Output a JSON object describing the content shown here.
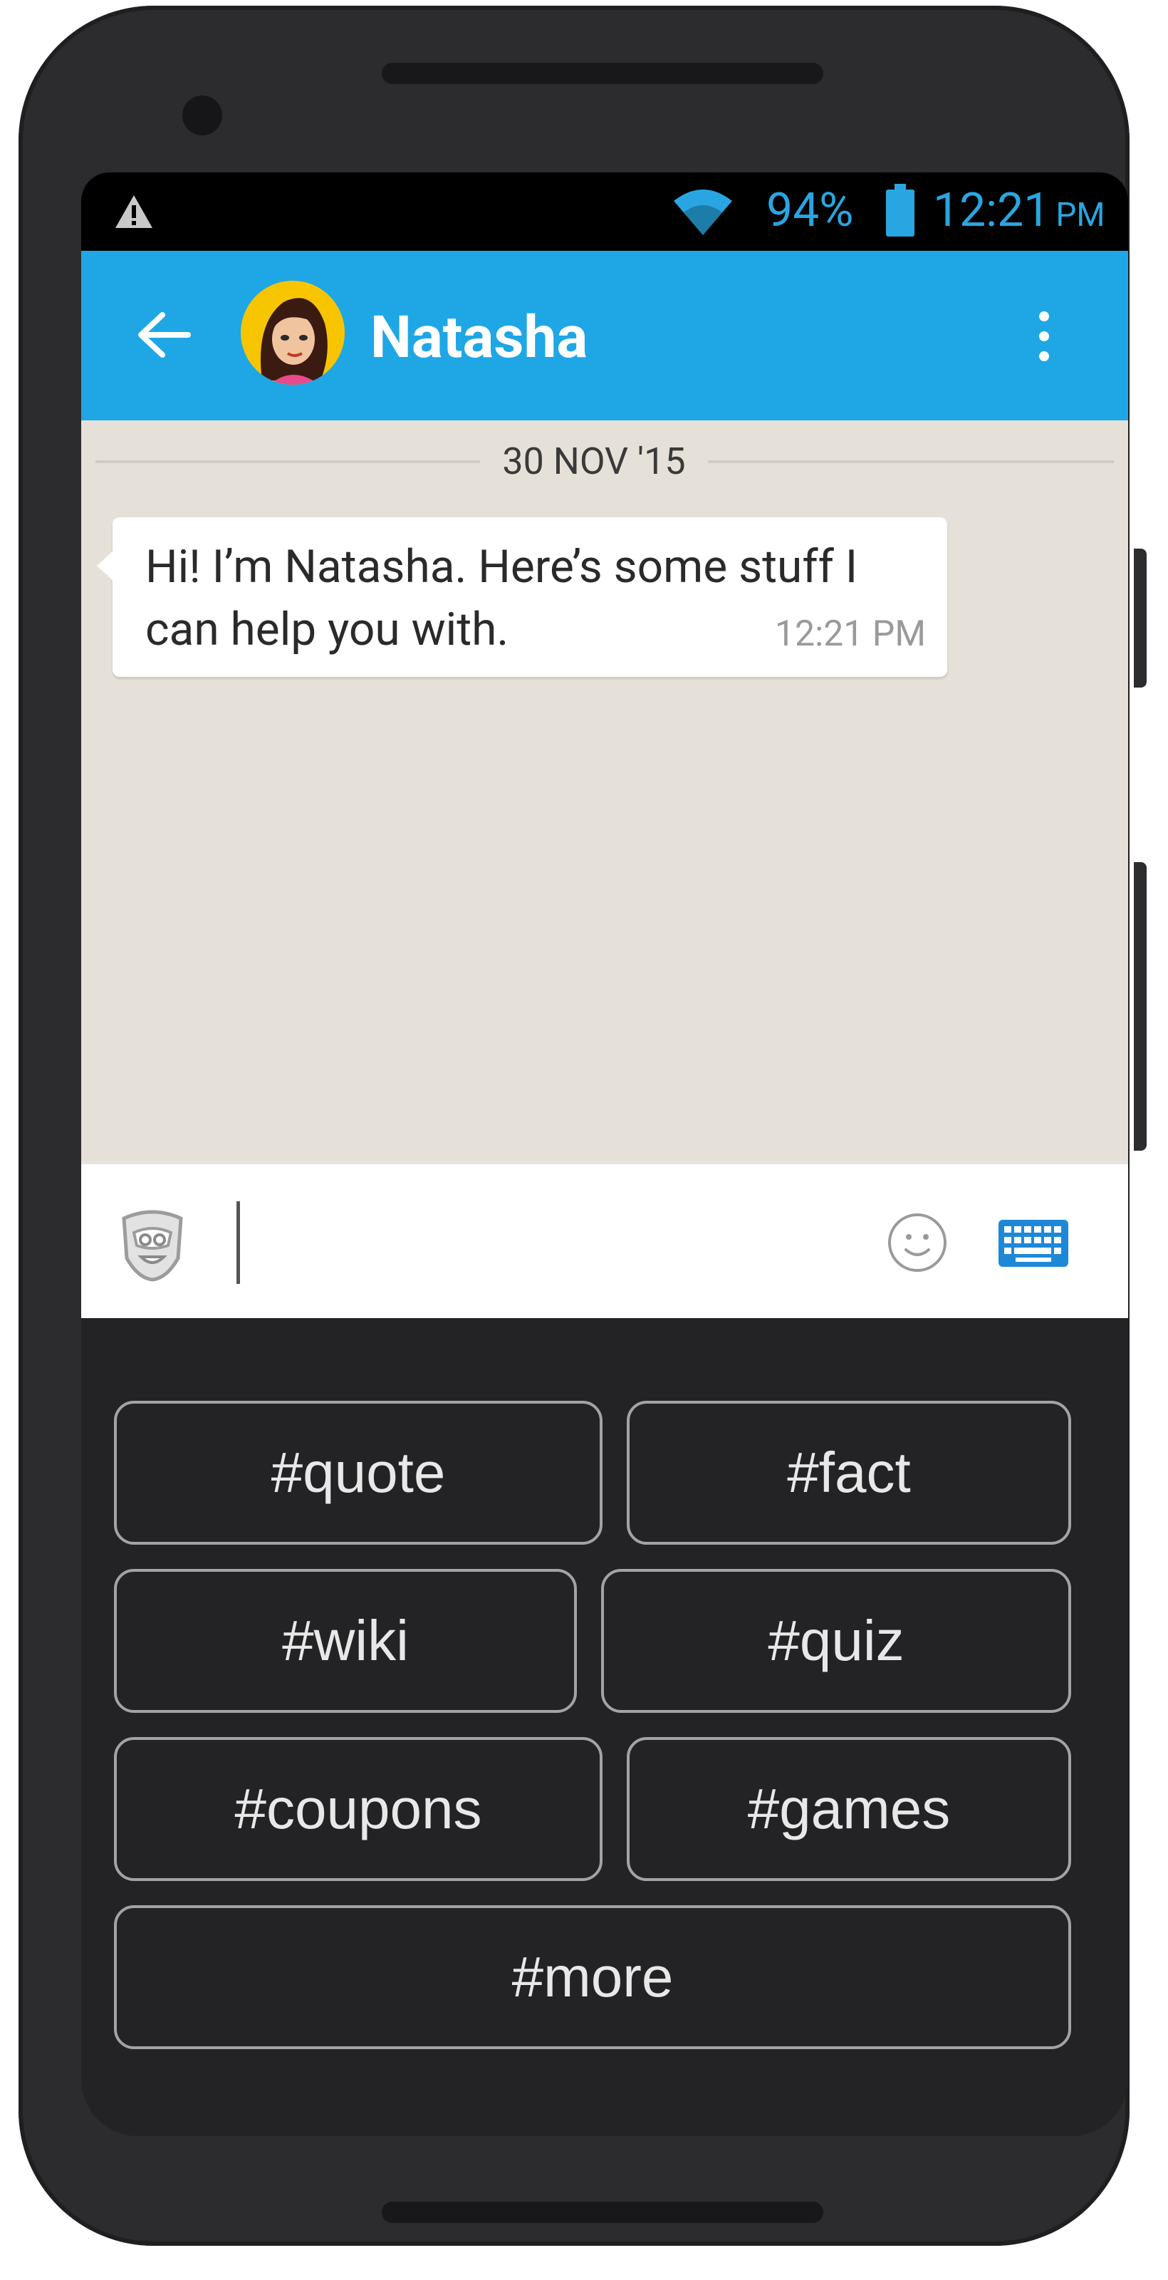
{
  "status_bar": {
    "warning_icon": "warning-triangle-icon",
    "wifi_icon": "wifi-icon",
    "battery_percent": "94%",
    "battery_icon": "battery-icon",
    "time": "12:21",
    "time_ampm": "PM"
  },
  "toolbar": {
    "back_icon": "arrow-back-icon",
    "contact_name": "Natasha",
    "menu_icon": "more-vert-icon",
    "color": "#1ea7e4"
  },
  "chat": {
    "date_label": "30 NOV '15",
    "messages": [
      {
        "text": "Hi! I’m Natasha. Here’s some stuff I can help you with.",
        "time": "12:21 PM"
      }
    ]
  },
  "composer": {
    "bot_icon": "bot-face-icon",
    "input_value": "",
    "emoji_icon": "smiley-icon",
    "keyboard_icon": "keyboard-icon"
  },
  "quick_replies": [
    {
      "label": "#quote"
    },
    {
      "label": "#fact"
    },
    {
      "label": "#wiki"
    },
    {
      "label": "#quiz"
    },
    {
      "label": "#coupons"
    },
    {
      "label": "#games"
    },
    {
      "label": "#more"
    }
  ]
}
